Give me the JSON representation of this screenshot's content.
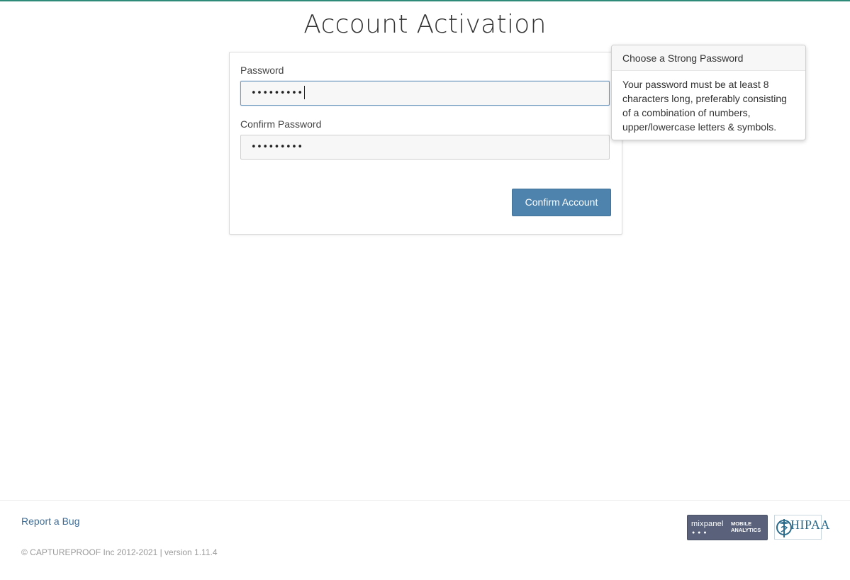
{
  "page": {
    "title": "Account Activation"
  },
  "form": {
    "password_label": "Password",
    "password_value": "•••••••••",
    "confirm_label": "Confirm Password",
    "confirm_value": "•••••••••",
    "submit_label": "Confirm Account"
  },
  "popover": {
    "title": "Choose a Strong Password",
    "body": "Your password must be at least 8 characters long, preferably consisting of a combination of numbers, upper/lowercase letters & symbols."
  },
  "footer": {
    "report_bug": "Report a Bug",
    "copyright": "© CAPTUREPROOF Inc 2012-2021 | version 1.11.4",
    "mixpanel_word": "mixpanel",
    "mixpanel_sub_line1": "MOBILE",
    "mixpanel_sub_line2": "ANALYTICS",
    "hipaa_text": "HIPAA"
  },
  "colors": {
    "accent": "#4e83ae",
    "link": "#3f6e98",
    "top_rule": "#2e8b7a"
  },
  "icons": {
    "mixpanel": "mixpanel-logo-icon",
    "hipaa": "hipaa-caduceus-icon"
  }
}
